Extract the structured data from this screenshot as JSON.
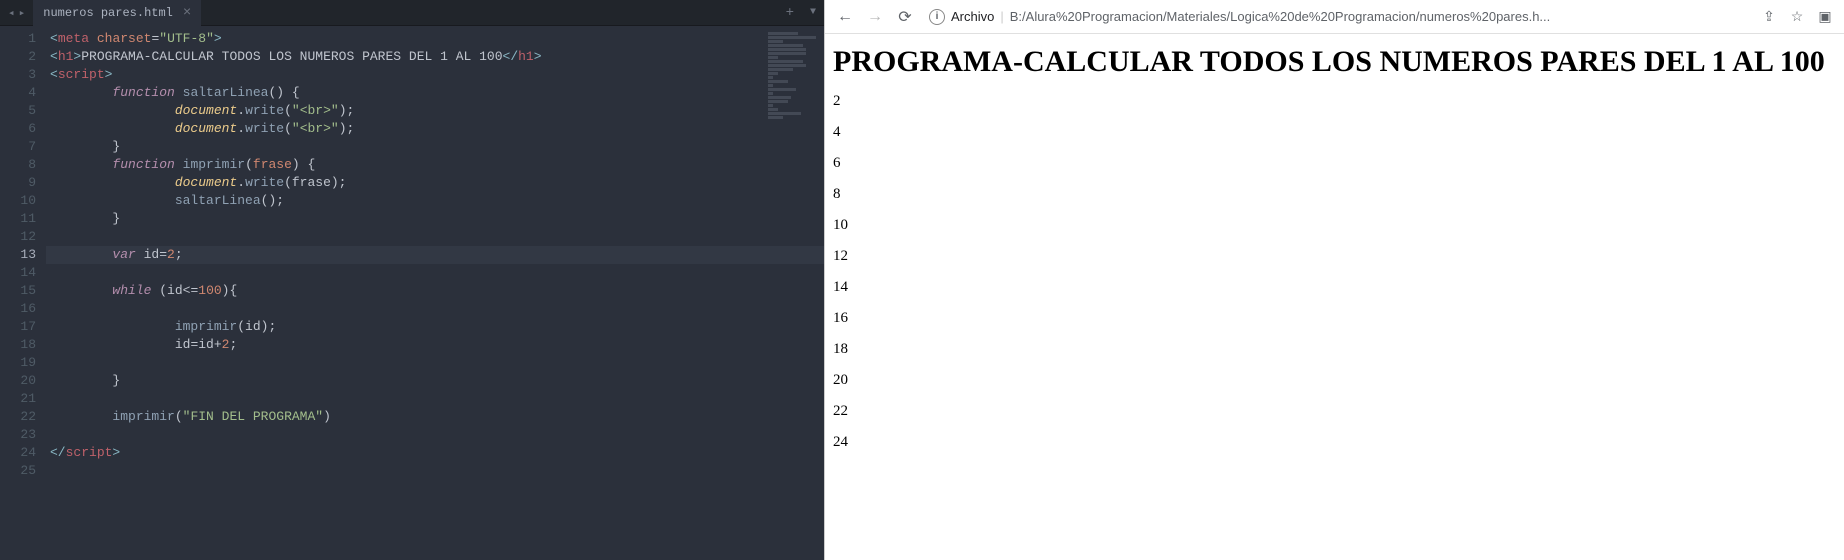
{
  "editor": {
    "tab": {
      "title": "numeros pares.html"
    },
    "activeLine": 13,
    "lines": [
      {
        "n": 1,
        "indent": 0,
        "tokens": [
          [
            "pun",
            "<"
          ],
          [
            "tag",
            "meta"
          ],
          [
            "txt",
            " "
          ],
          [
            "attr",
            "charset"
          ],
          [
            "op",
            "="
          ],
          [
            "str",
            "\"UTF-8\""
          ],
          [
            "pun",
            ">"
          ]
        ]
      },
      {
        "n": 2,
        "indent": 0,
        "tokens": [
          [
            "pun",
            "<"
          ],
          [
            "tag",
            "h1"
          ],
          [
            "pun",
            ">"
          ],
          [
            "txt",
            "PROGRAMA-CALCULAR TODOS LOS NUMEROS PARES DEL 1 AL 100"
          ],
          [
            "pun",
            "</"
          ],
          [
            "tag",
            "h1"
          ],
          [
            "pun",
            ">"
          ]
        ]
      },
      {
        "n": 3,
        "indent": 0,
        "tokens": [
          [
            "pun",
            "<"
          ],
          [
            "tag",
            "script"
          ],
          [
            "pun",
            ">"
          ]
        ]
      },
      {
        "n": 4,
        "indent": 2,
        "tokens": [
          [
            "def",
            "function"
          ],
          [
            "txt",
            " "
          ],
          [
            "fnname",
            "saltarLinea"
          ],
          [
            "txt",
            "() {"
          ]
        ]
      },
      {
        "n": 5,
        "indent": 4,
        "tokens": [
          [
            "obj",
            "document"
          ],
          [
            "txt",
            "."
          ],
          [
            "fnname",
            "write"
          ],
          [
            "txt",
            "("
          ],
          [
            "str",
            "\"<br>\""
          ],
          [
            "txt",
            ");"
          ]
        ]
      },
      {
        "n": 6,
        "indent": 4,
        "tokens": [
          [
            "obj",
            "document"
          ],
          [
            "txt",
            "."
          ],
          [
            "fnname",
            "write"
          ],
          [
            "txt",
            "("
          ],
          [
            "str",
            "\"<br>\""
          ],
          [
            "txt",
            ");"
          ]
        ]
      },
      {
        "n": 7,
        "indent": 2,
        "tokens": [
          [
            "txt",
            "}"
          ]
        ]
      },
      {
        "n": 8,
        "indent": 2,
        "tokens": [
          [
            "def",
            "function"
          ],
          [
            "txt",
            " "
          ],
          [
            "fnname",
            "imprimir"
          ],
          [
            "txt",
            "("
          ],
          [
            "par",
            "frase"
          ],
          [
            "txt",
            ") {"
          ]
        ]
      },
      {
        "n": 9,
        "indent": 4,
        "tokens": [
          [
            "obj",
            "document"
          ],
          [
            "txt",
            "."
          ],
          [
            "fnname",
            "write"
          ],
          [
            "txt",
            "(frase);"
          ]
        ]
      },
      {
        "n": 10,
        "indent": 4,
        "tokens": [
          [
            "fnname",
            "saltarLinea"
          ],
          [
            "txt",
            "();"
          ]
        ]
      },
      {
        "n": 11,
        "indent": 2,
        "tokens": [
          [
            "txt",
            "}"
          ]
        ]
      },
      {
        "n": 12,
        "indent": 0,
        "tokens": []
      },
      {
        "n": 13,
        "indent": 2,
        "tokens": [
          [
            "kw",
            "var"
          ],
          [
            "txt",
            " id"
          ],
          [
            "op",
            "="
          ],
          [
            "num",
            "2"
          ],
          [
            "txt",
            ";"
          ]
        ]
      },
      {
        "n": 14,
        "indent": 0,
        "tokens": []
      },
      {
        "n": 15,
        "indent": 2,
        "tokens": [
          [
            "kw",
            "while"
          ],
          [
            "txt",
            " (id"
          ],
          [
            "op",
            "<="
          ],
          [
            "num",
            "100"
          ],
          [
            "txt",
            "){"
          ]
        ]
      },
      {
        "n": 16,
        "indent": 0,
        "tokens": []
      },
      {
        "n": 17,
        "indent": 4,
        "tokens": [
          [
            "fnname",
            "imprimir"
          ],
          [
            "txt",
            "(id);"
          ]
        ]
      },
      {
        "n": 18,
        "indent": 4,
        "tokens": [
          [
            "txt",
            "id"
          ],
          [
            "op",
            "="
          ],
          [
            "txt",
            "id"
          ],
          [
            "op",
            "+"
          ],
          [
            "num",
            "2"
          ],
          [
            "txt",
            ";"
          ]
        ]
      },
      {
        "n": 19,
        "indent": 0,
        "tokens": []
      },
      {
        "n": 20,
        "indent": 2,
        "tokens": [
          [
            "txt",
            "}"
          ]
        ]
      },
      {
        "n": 21,
        "indent": 0,
        "tokens": []
      },
      {
        "n": 22,
        "indent": 2,
        "tokens": [
          [
            "fnname",
            "imprimir"
          ],
          [
            "txt",
            "("
          ],
          [
            "str",
            "\"FIN DEL PROGRAMA\""
          ],
          [
            "txt",
            ")"
          ]
        ]
      },
      {
        "n": 23,
        "indent": 0,
        "tokens": []
      },
      {
        "n": 24,
        "indent": 0,
        "tokens": [
          [
            "pun",
            "</"
          ],
          [
            "tag",
            "script"
          ],
          [
            "pun",
            ">"
          ]
        ]
      },
      {
        "n": 25,
        "indent": 0,
        "tokens": []
      }
    ]
  },
  "browser": {
    "addr": {
      "label": "Archivo",
      "url": "B:/Alura%20Programacion/Materiales/Logica%20de%20Programacion/numeros%20pares.h..."
    },
    "page": {
      "heading": "PROGRAMA-CALCULAR TODOS LOS NUMEROS PARES DEL 1 AL 100",
      "numbers": [
        "2",
        "4",
        "6",
        "8",
        "10",
        "12",
        "14",
        "16",
        "18",
        "20",
        "22",
        "24"
      ]
    },
    "icons": {
      "back": "←",
      "forward": "→",
      "reload": "⟳",
      "info": "i",
      "share": "⇪",
      "star": "☆",
      "ext": "▣"
    }
  }
}
